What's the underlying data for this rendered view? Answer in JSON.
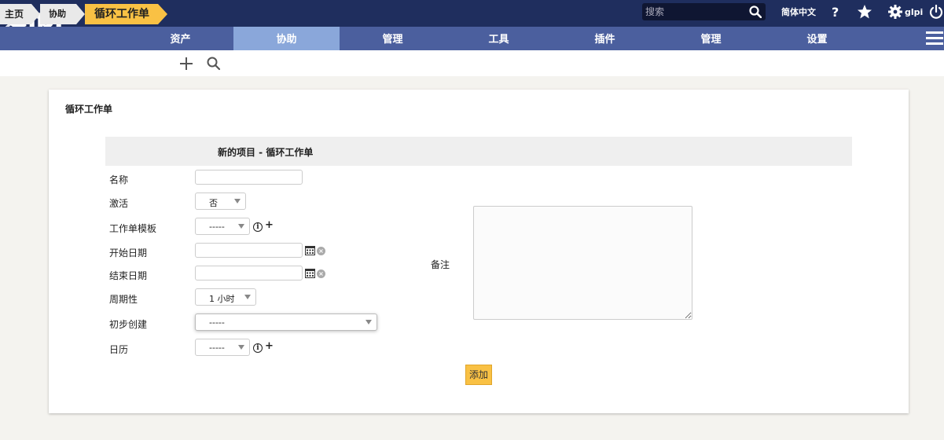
{
  "header": {
    "logo_text": "Glpi",
    "search_placeholder": "搜索",
    "language": "简体中文",
    "user": "glpi"
  },
  "menu": {
    "items": [
      "资产",
      "协助",
      "管理",
      "工具",
      "插件",
      "管理",
      "设置"
    ],
    "active_index": 1
  },
  "breadcrumb": {
    "items": [
      "主页",
      "协助",
      "循环工作单"
    ]
  },
  "panel": {
    "title": "循环工作单",
    "form_title": "新的项目 - 循环工作单"
  },
  "form": {
    "name_label": "名称",
    "active_label": "激活",
    "active_value": "否",
    "template_label": "工作单模板",
    "template_value": "-----",
    "start_label": "开始日期",
    "end_label": "结束日期",
    "period_label": "周期性",
    "period_value": "1 小时",
    "creation_label": "初步创建",
    "creation_value": "-----",
    "calendar_label": "日历",
    "calendar_value": "-----",
    "comment_label": "备注",
    "submit_label": "添加"
  },
  "colors": {
    "header_bg": "#1f2e5e",
    "menu_bg": "#4b5f9e",
    "menu_active": "#8aa7da",
    "accent": "#f9c144"
  }
}
